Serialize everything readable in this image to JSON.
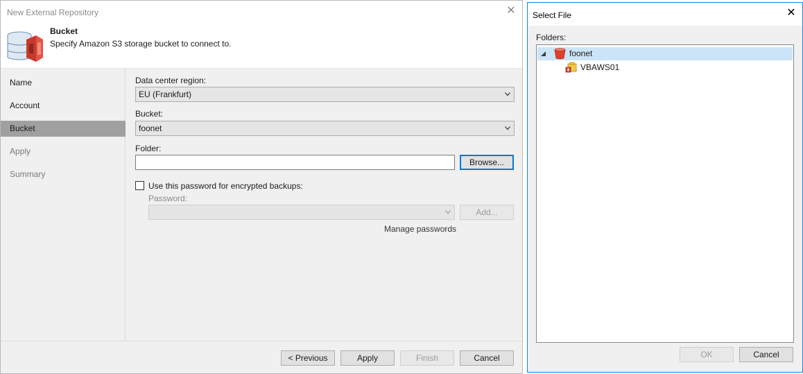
{
  "wizard": {
    "title": "New External Repository",
    "step_title": "Bucket",
    "step_description": "Specify Amazon S3 storage bucket to connect to.",
    "nav": [
      {
        "label": "Name",
        "state": "done"
      },
      {
        "label": "Account",
        "state": "done"
      },
      {
        "label": "Bucket",
        "state": "active"
      },
      {
        "label": "Apply",
        "state": "disabled"
      },
      {
        "label": "Summary",
        "state": "disabled"
      }
    ],
    "form": {
      "region_label": "Data center region:",
      "region_value": "EU (Frankfurt)",
      "bucket_label": "Bucket:",
      "bucket_value": "foonet",
      "folder_label": "Folder:",
      "folder_value": "",
      "browse_label": "Browse...",
      "encrypt_label": "Use this password for encrypted backups:",
      "encrypt_checked": false,
      "password_label": "Password:",
      "password_value": "",
      "add_label": "Add...",
      "manage_label": "Manage passwords"
    },
    "footer": {
      "previous": "< Previous",
      "apply": "Apply",
      "finish": "Finish",
      "cancel": "Cancel"
    }
  },
  "dialog": {
    "title": "Select File",
    "folders_label": "Folders:",
    "tree": [
      {
        "label": "foonet",
        "icon": "bucket-icon",
        "expanded": true,
        "selected": true
      },
      {
        "label": "VBAWS01",
        "icon": "backup-folder-icon",
        "selected": false
      }
    ],
    "ok": "OK",
    "cancel": "Cancel"
  },
  "colors": {
    "accent": "#0078d7",
    "nav_active": "#a0a0a0",
    "tree_selected": "#cce4f7",
    "bucket_red": "#d9412e"
  }
}
